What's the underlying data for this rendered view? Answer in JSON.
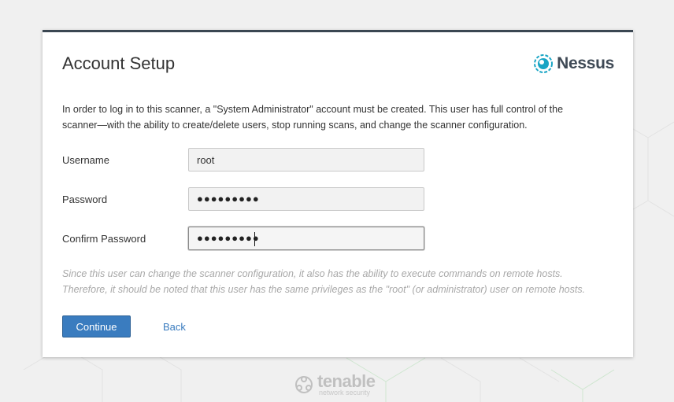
{
  "page": {
    "title": "Account Setup"
  },
  "brand": {
    "name": "Nessus",
    "icon": "nessus-logo-icon",
    "color": "#3f4a56",
    "accent": "#19a5c5"
  },
  "intro": {
    "line1": "In order to log in to this scanner, a \"System Administrator\" account must be created. This user has full control of the",
    "line2": "scanner—with the ability to create/delete users, stop running scans, and change the scanner configuration."
  },
  "form": {
    "username": {
      "label": "Username",
      "value": "root"
    },
    "password": {
      "label": "Password",
      "value": "●●●●●●●●●"
    },
    "confirm": {
      "label": "Confirm Password",
      "value": "●●●●●●●●●"
    }
  },
  "warning": {
    "line1": "Since this user can change the scanner configuration, it also has the ability to execute commands on remote hosts.",
    "line2": "Therefore, it should be noted that this user has the same privileges as the \"root\" (or administrator) user on remote hosts."
  },
  "actions": {
    "continue_label": "Continue",
    "back_label": "Back"
  },
  "footer": {
    "brand": "tenable",
    "subtitle": "network security",
    "icon": "tenable-logo-icon"
  },
  "colors": {
    "primary_button": "#3a7cbf",
    "card_top_border": "#3b4752",
    "background": "#f0f0f0"
  }
}
